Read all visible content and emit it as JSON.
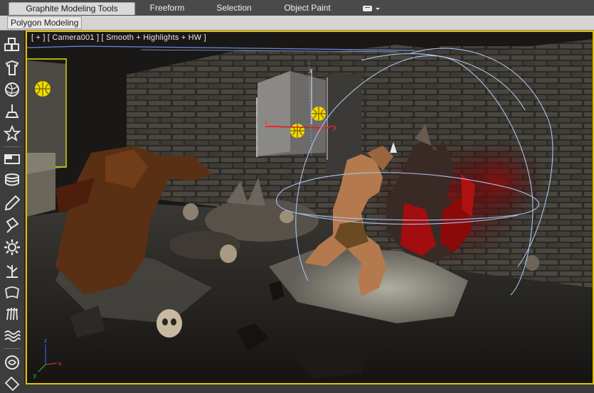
{
  "ribbon": {
    "tabs": [
      {
        "label": "Graphite Modeling Tools",
        "active": true
      },
      {
        "label": "Freeform",
        "active": false
      },
      {
        "label": "Selection",
        "active": false
      },
      {
        "label": "Object Paint",
        "active": false
      }
    ],
    "dropdown_icon": "display-dropdown-icon",
    "panel_label": "Polygon Modeling"
  },
  "command_toolbar": {
    "icons": [
      "create-geometry-icon",
      "modify-icon",
      "material-sphere-icon",
      "light-icon",
      "helper-star-icon",
      "box-select-icon",
      "layers-icon",
      "brush-icon",
      "paint-icon",
      "gear-icon",
      "tree-icon",
      "cloth-icon",
      "hair-icon",
      "wave-icon",
      "link-icon"
    ]
  },
  "viewport": {
    "label": "[ + ] [ Camera001 ] [ Smooth + Highlights + HW ]",
    "active_border_color": "#e2c000",
    "gizmo_axes": [
      "x",
      "y",
      "z"
    ]
  }
}
